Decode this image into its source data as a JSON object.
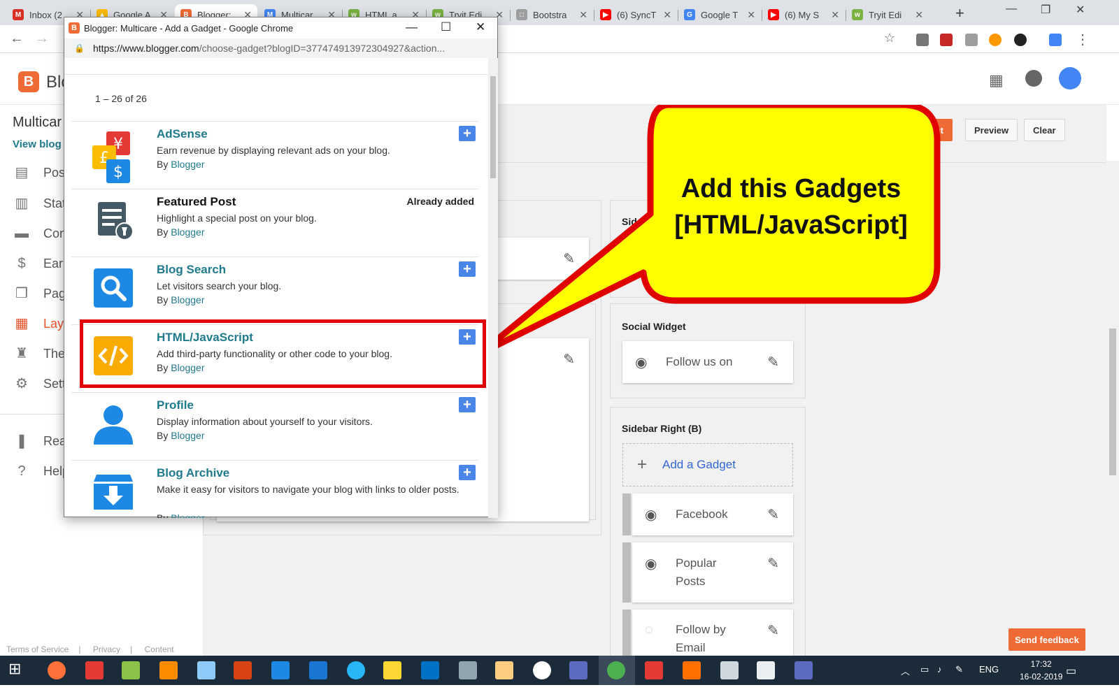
{
  "browser": {
    "tabs": [
      {
        "label": "Inbox (2",
        "color": "#d93025",
        "glyph": "M"
      },
      {
        "label": "Google A",
        "color": "#fbbc04",
        "glyph": "▲"
      },
      {
        "label": "Blogger:",
        "color": "#f06a35",
        "glyph": "B"
      },
      {
        "label": "Multicar",
        "color": "#4285f4",
        "glyph": "M"
      },
      {
        "label": "HTML a",
        "color": "#7cb342",
        "glyph": "w"
      },
      {
        "label": "Tryit Edi",
        "color": "#7cb342",
        "glyph": "w"
      },
      {
        "label": "Bootstra",
        "color": "#9e9e9e",
        "glyph": "□"
      },
      {
        "label": "(6) SyncT",
        "color": "#ff0000",
        "glyph": "▶"
      },
      {
        "label": "Google T",
        "color": "#4285f4",
        "glyph": "G"
      },
      {
        "label": "(6) My S",
        "color": "#ff0000",
        "glyph": "▶"
      },
      {
        "label": "Tryit Edi",
        "color": "#7cb342",
        "glyph": "w"
      }
    ],
    "new_tab": "+",
    "close_glyph": "✕"
  },
  "blogger": {
    "logo_letter": "B",
    "word": "Blo",
    "blog_name": "Multicar",
    "view_blog": "View blog",
    "nav": [
      {
        "label": "Pos",
        "icon": "posts-icon",
        "glyph": "▤"
      },
      {
        "label": "Stat",
        "icon": "stats-icon",
        "glyph": "▥"
      },
      {
        "label": "Con",
        "icon": "comments-icon",
        "glyph": "▬"
      },
      {
        "label": "Earn",
        "icon": "earnings-icon",
        "glyph": "$"
      },
      {
        "label": "Pag",
        "icon": "pages-icon",
        "glyph": "❐"
      },
      {
        "label": "Layo",
        "icon": "layout-icon",
        "glyph": "▦"
      },
      {
        "label": "The",
        "icon": "theme-icon",
        "glyph": "♜"
      },
      {
        "label": "Sett",
        "icon": "settings-icon",
        "glyph": "⚙"
      },
      {
        "label": "Rea",
        "icon": "reading-list-icon",
        "glyph": "❚"
      },
      {
        "label": "Help",
        "icon": "help-icon",
        "glyph": "?"
      }
    ],
    "footer": [
      "Terms of Service",
      "Privacy",
      "Content Policy"
    ],
    "buttons": {
      "save": "nt",
      "preview": "Preview",
      "clear": "Clear"
    },
    "sections": {
      "sidebar_top_title": "Sid",
      "social_title": "Social Widget",
      "social_gadget": "Follow us on",
      "sidebar_b_title": "Sidebar Right (B)",
      "add_gadget": "Add a Gadget",
      "gadgets": [
        "Facebook",
        "Popular Posts",
        "Follow by Email"
      ]
    },
    "send_feedback": "Send feedback"
  },
  "popup": {
    "title": "Blogger: Multicare - Add a Gadget - Google Chrome",
    "url_host": "https://www.blogger.com",
    "url_rest": "/choose-gadget?blogID=377474913972304927&action...",
    "count": "1 – 26 of 26",
    "by_prefix": "By",
    "items": [
      {
        "name": "AdSense",
        "desc": "Earn revenue by displaying relevant ads on your blog.",
        "by": "Blogger",
        "icon": "adsense-icon",
        "added": false
      },
      {
        "name": "Featured Post",
        "desc": "Highlight a special post on your blog.",
        "by": "Blogger",
        "icon": "featured-post-icon",
        "added": true,
        "added_label": "Already added"
      },
      {
        "name": "Blog Search",
        "desc": "Let visitors search your blog.",
        "by": "Blogger",
        "icon": "search-icon",
        "added": false
      },
      {
        "name": "HTML/JavaScript",
        "desc": "Add third-party functionality or other code to your blog.",
        "by": "Blogger",
        "icon": "code-icon",
        "added": false
      },
      {
        "name": "Profile",
        "desc": "Display information about yourself to your visitors.",
        "by": "Blogger",
        "icon": "profile-icon",
        "added": false
      },
      {
        "name": "Blog Archive",
        "desc": "Make it easy for visitors to navigate your blog with links to older posts.",
        "by": "Blogger",
        "icon": "archive-icon",
        "added": false
      }
    ]
  },
  "callout": {
    "line1": "Add this Gadgets",
    "line2": "[HTML/JavaScript]"
  },
  "taskbar": {
    "lang": "ENG",
    "time": "17:32",
    "date": "16-02-2019"
  },
  "colors": {
    "accent": "#f06a35",
    "highlight": "#e00000",
    "callout_fill": "#ffff00",
    "link": "#1f7a8c"
  }
}
